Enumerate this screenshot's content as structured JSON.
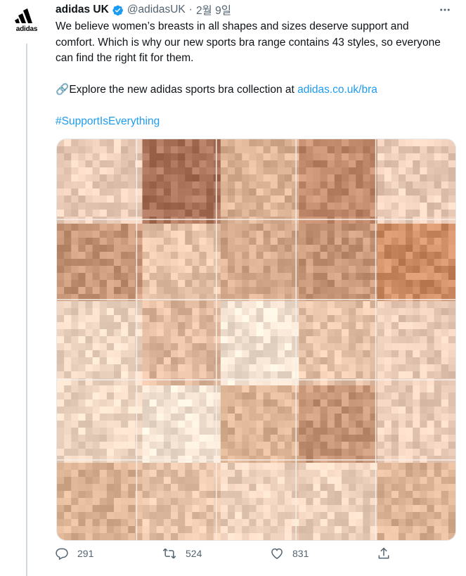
{
  "account": {
    "name": "adidas UK",
    "handle": "@adidasUK",
    "separator": "·",
    "date": "2월 9일",
    "logo_word": "adidas",
    "brand_color": "#000000",
    "verified_color": "#1d9bf0"
  },
  "tweet": {
    "line1": "We believe women’s breasts in all shapes and sizes deserve support and comfort. Which is why our new sports bra range contains 43 styles, so everyone can find the right fit for them.",
    "explore_icon": "link-emoji-icon",
    "explore_text": "Explore the new adidas sports bra collection at",
    "explore_link": "adidas.co.uk/bra",
    "hashtag": "#SupportIsEverything",
    "link_color": "#1d9bf0"
  },
  "media": {
    "description_icon": "pixelated-photo-grid-icon",
    "grid_columns": 5,
    "grid_rows": 5
  },
  "actions": {
    "reply_count": "291",
    "retweet_count": "524",
    "like_count": "831"
  }
}
